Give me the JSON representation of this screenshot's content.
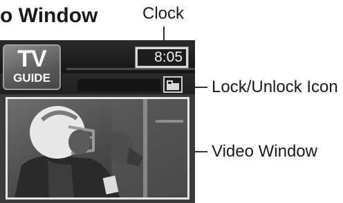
{
  "heading": "o Window",
  "device": {
    "logo_line1": "TV",
    "logo_line2": "GUIDE",
    "clock_time": "8:05"
  },
  "callouts": {
    "clock": "Clock",
    "lock": "Lock/Unlock Icon",
    "video": "Video Window"
  },
  "icons": {
    "lock": "lock-unlock-icon"
  }
}
